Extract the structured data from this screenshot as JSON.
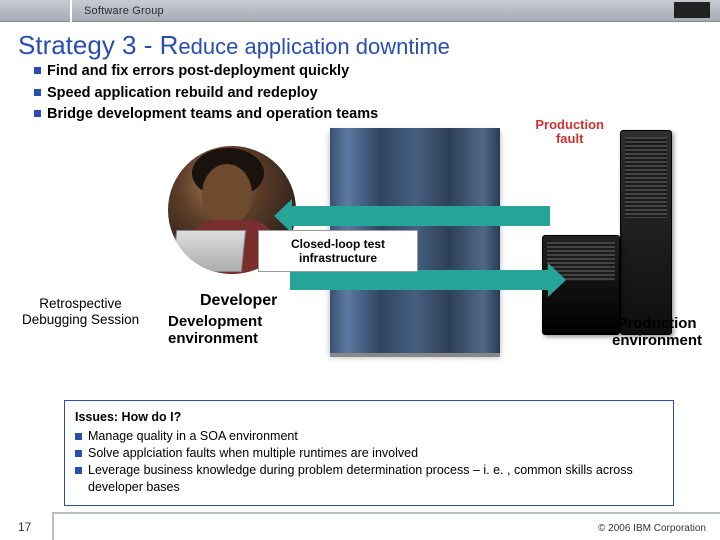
{
  "topbar": {
    "label": "Software Group",
    "logo_alt": "IBM"
  },
  "title": {
    "main": "Strategy 3 - R",
    "rest": "educe application downtime"
  },
  "bullets": [
    "Find and fix errors post-deployment quickly",
    "Speed application rebuild and redeploy",
    "Bridge development teams and operation teams"
  ],
  "diagram": {
    "prod_fault": "Production\nfault",
    "loop_box": "Closed-loop test infrastructure",
    "retro": "Retrospective\nDebugging Session",
    "developer": "Developer",
    "dev_env": "Development\nenvironment",
    "prod_env": "Production\nenvironment"
  },
  "issues": {
    "header": "Issues: How do I?",
    "items": [
      "Manage quality in a SOA environment",
      "Solve applciation faults when multiple runtimes are involved",
      "Leverage business knowledge during problem determination process – i. e. , common skills across developer bases"
    ]
  },
  "footer": {
    "slide_no": "17",
    "copyright": "© 2006 IBM Corporation"
  }
}
